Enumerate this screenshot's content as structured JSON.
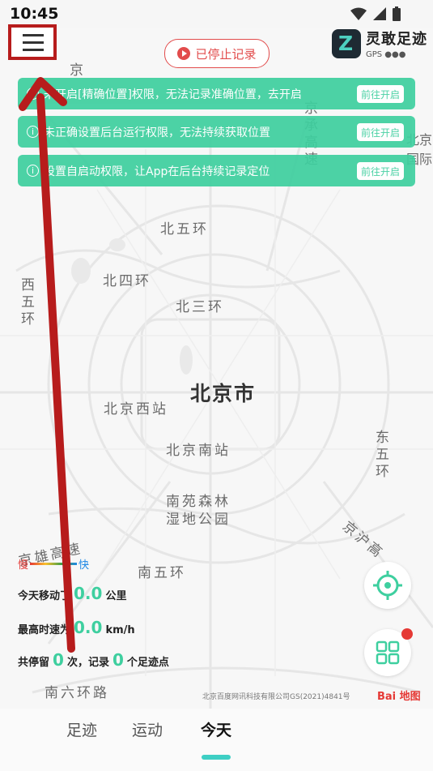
{
  "status_bar": {
    "time": "10:45"
  },
  "header": {
    "record_status": "已停止记录",
    "app_name": "灵敢足迹",
    "gps_label": "GPS ●●●"
  },
  "banners": [
    {
      "text": "未开启[精确位置]权限，无法记录准确位置，去开启",
      "button": "前往开启"
    },
    {
      "text": "未正确设置后台运行权限，无法持续获取位置",
      "button": "前往开启"
    },
    {
      "text": "设置自启动权限，让App在后台持续记录定位",
      "button": "前往开启"
    }
  ],
  "map_labels": {
    "north5": "北五环",
    "north4": "北四环",
    "north3": "北三环",
    "west5": "西五环",
    "city": "北京市",
    "west_station": "北京西站",
    "south_station": "北京南站",
    "nanyuan": "南苑森林\n湿地公园",
    "east5": "东五环",
    "south5": "南五环",
    "south6": "南六环路",
    "xiongan": "京雄高速",
    "jinghu": "京沪高",
    "jingcheng": "京承高速",
    "airport": "北京国际",
    "jing": "京"
  },
  "speed_legend": {
    "slow": "慢",
    "fast": "快"
  },
  "stats": {
    "distance_label": "今天移动了",
    "distance_value": "0.0",
    "distance_unit": "公里",
    "maxspeed_label": "最高时速为",
    "maxspeed_value": "0.0",
    "maxspeed_unit": "km/h",
    "stay_prefix": "共停留",
    "stay_value": "0",
    "stay_mid": "次，记录",
    "points_value": "0",
    "points_suffix": "个足迹点"
  },
  "copyright": "北京百度网讯科技有限公司GS(2021)4841号",
  "baidu_logo": "Bai 地图",
  "nav": {
    "tabs": [
      "足迹",
      "运动",
      "今天"
    ],
    "active": "今天"
  },
  "colors": {
    "accent": "#3ecf9f",
    "record_red": "#e24c4c",
    "annotation": "#b71c1c"
  }
}
